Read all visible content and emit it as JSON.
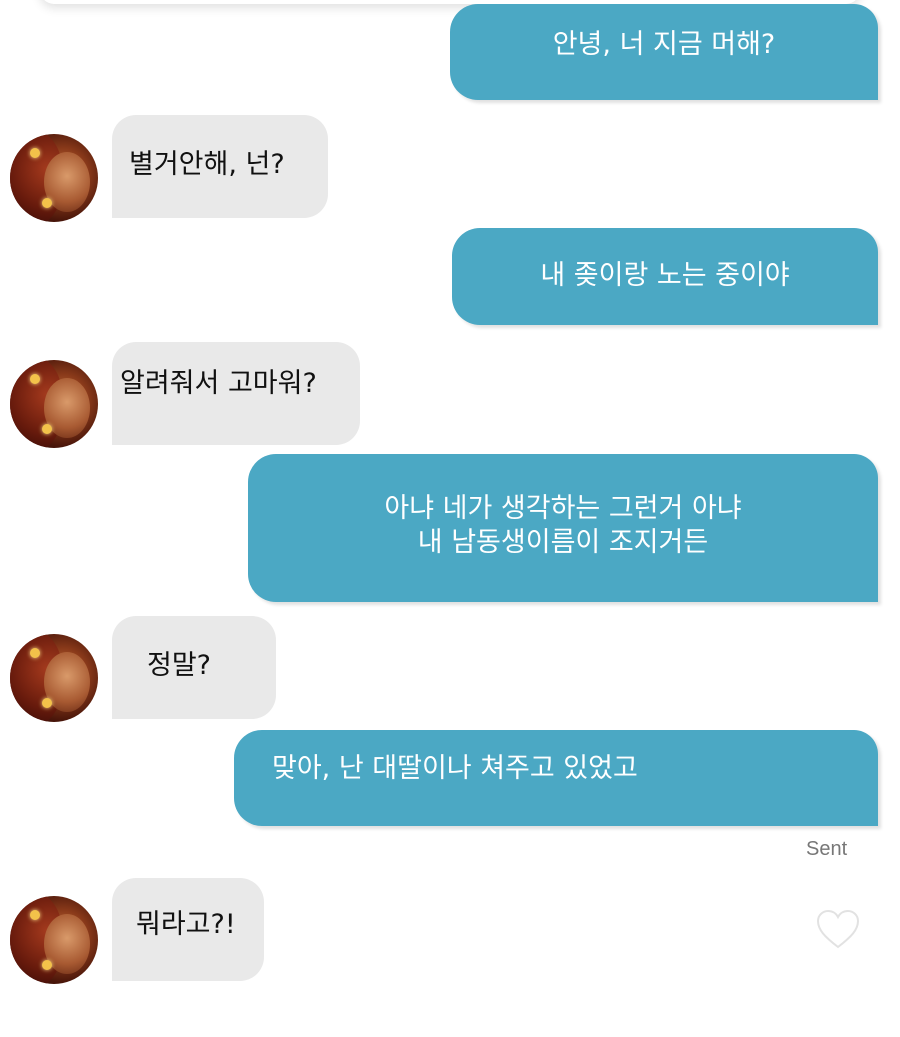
{
  "messages": [
    {
      "from": "me",
      "lines": [
        "안녕, 너 지금 머해?"
      ]
    },
    {
      "from": "them",
      "lines": [
        "별거안해, 넌?"
      ]
    },
    {
      "from": "me",
      "lines": [
        "내 좆이랑 노는 중이야"
      ]
    },
    {
      "from": "them",
      "lines": [
        "알려줘서 고마워?"
      ]
    },
    {
      "from": "me",
      "lines": [
        "아냐 네가 생각하는 그런거 아냐",
        "내 남동생이름이 조지거든"
      ]
    },
    {
      "from": "them",
      "lines": [
        "정말?"
      ]
    },
    {
      "from": "me",
      "lines": [
        "맞아, 난 대딸이나 쳐주고 있었고"
      ]
    },
    {
      "from": "them",
      "lines": [
        "뭐라고?!"
      ]
    }
  ],
  "status": {
    "sent_label": "Sent"
  },
  "icons": {
    "like": "heart-outline-icon",
    "avatar": "contact-avatar"
  },
  "colors": {
    "sent_bubble": "#4ba8c4",
    "received_bubble": "#e9e9e9"
  }
}
